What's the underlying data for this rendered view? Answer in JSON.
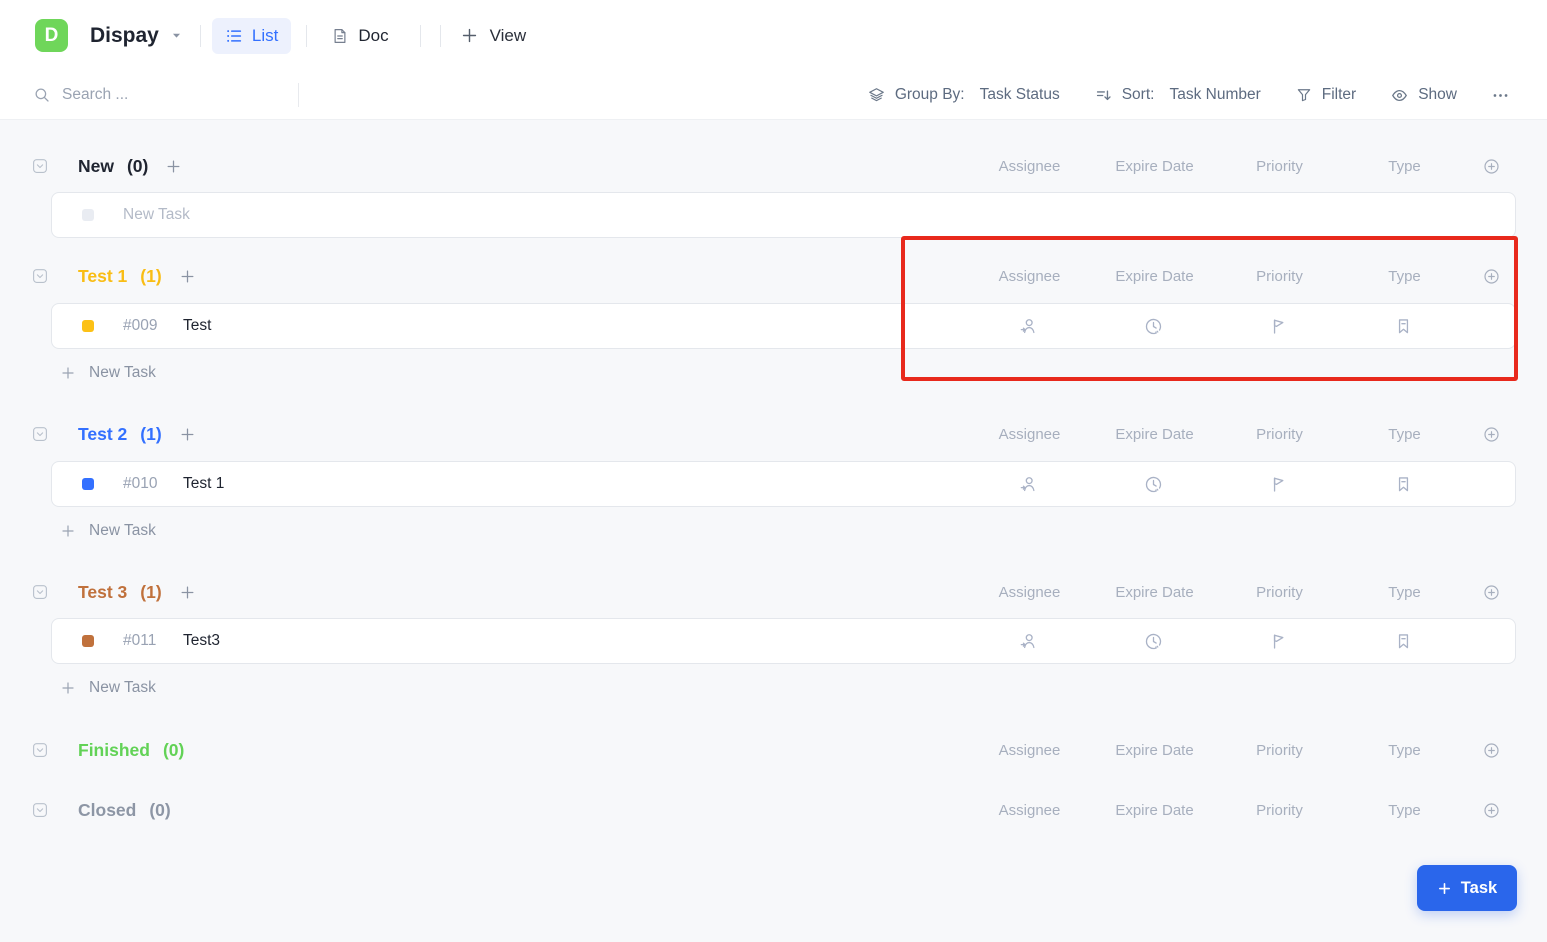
{
  "app": {
    "logo_letter": "D",
    "project_title": "Dispay"
  },
  "topbar": {
    "tabs": [
      {
        "label": "List",
        "active": true
      },
      {
        "label": "Doc",
        "active": false
      }
    ],
    "view_label": "View"
  },
  "toolbar": {
    "search_placeholder": "Search ...",
    "group_by_label": "Group By:",
    "group_by_value": "Task Status",
    "sort_label": "Sort:",
    "sort_value": "Task Number",
    "filter_label": "Filter",
    "show_label": "Show"
  },
  "columns": [
    "Assignee",
    "Expire Date",
    "Priority",
    "Type"
  ],
  "groups": [
    {
      "name": "New",
      "count": "(0)",
      "color": "#1f2430",
      "bullet_color": "#e9ecf2",
      "placeholder": "New Task"
    },
    {
      "name": "Test 1",
      "count": "(1)",
      "color": "#f9bd15",
      "task": {
        "id": "#009",
        "title": "Test",
        "bullet_color": "#fcc116"
      }
    },
    {
      "name": "Test 2",
      "count": "(1)",
      "color": "#3370ff",
      "task": {
        "id": "#010",
        "title": "Test 1",
        "bullet_color": "#3370ff"
      }
    },
    {
      "name": "Test 3",
      "count": "(1)",
      "color": "#c0713c",
      "task": {
        "id": "#011",
        "title": "Test3",
        "bullet_color": "#c0713c"
      }
    },
    {
      "name": "Finished",
      "count": "(0)",
      "color": "#62d256"
    },
    {
      "name": "Closed",
      "count": "(0)",
      "color": "#8d96a5"
    }
  ],
  "labels": {
    "new_task_link": "New Task",
    "add_task_button": "Task"
  },
  "icons": {
    "row_icons": [
      "assignee-add-icon",
      "expire-date-clock-icon",
      "priority-flag-icon",
      "type-bookmark-icon"
    ],
    "toolbar_icons": [
      "group-by-layers-icon",
      "sort-icon",
      "filter-funnel-icon",
      "show-eye-icon",
      "more-ellipsis-icon"
    ]
  },
  "colors": {
    "logo_green": "#6fd65a",
    "accent_blue": "#3370ff",
    "task_button_blue": "#2a66eb",
    "annotation_red": "#e8291c",
    "background": "#f7f8fa"
  }
}
